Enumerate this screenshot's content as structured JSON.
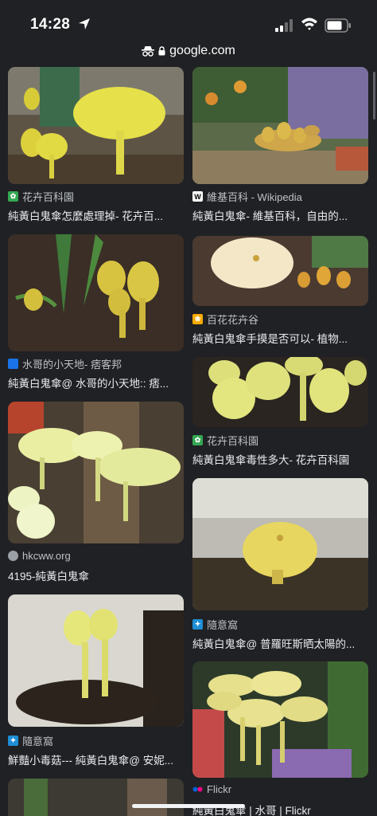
{
  "status": {
    "time": "14:28"
  },
  "browser": {
    "url": "google.com"
  },
  "results": [
    {
      "source": "花卉百科園",
      "title": "純黃白鬼傘怎麼處理掉- 花卉百...",
      "favicon": "leaf-icon",
      "favicon_color": "#34a853"
    },
    {
      "source": "維基百科 - Wikipedia",
      "title": "純黃白鬼傘- 維基百科，自由的...",
      "favicon": "wikipedia-icon",
      "favicon_color": "#ffffff"
    },
    {
      "source": "百花花卉谷",
      "title": "純黃白鬼傘手摸是否可以- 植物...",
      "favicon": "flower-icon",
      "favicon_color": "#f9ab00"
    },
    {
      "source": "水哥的小天地- 痞客邦",
      "title": "純黃白鬼傘@ 水哥的小天地:: 痞...",
      "favicon": "pixnet-icon",
      "favicon_color": "#1a73e8"
    },
    {
      "source": "花卉百科園",
      "title": "純黃白鬼傘毒性多大- 花卉百科園",
      "favicon": "leaf-icon",
      "favicon_color": "#34a853"
    },
    {
      "source": "hkcww.org",
      "title": "4195-純黃白鬼傘",
      "favicon": "globe-icon",
      "favicon_color": "#9aa0a6"
    },
    {
      "source": "隨意窩",
      "title": "純黃白鬼傘@ 普羅旺斯晒太陽的...",
      "favicon": "xuite-icon",
      "favicon_color": "#1e8fd6"
    },
    {
      "source": "隨意窩",
      "title": "鮮豔小毒菇--- 純黃白鬼傘@ 安妮...",
      "favicon": "xuite-icon",
      "favicon_color": "#1e8fd6"
    },
    {
      "source": "Flickr",
      "title": "純黃白鬼傘 | 水哥 | Flickr",
      "favicon": "flickr-icon",
      "favicon_color": "#0063dc"
    }
  ]
}
